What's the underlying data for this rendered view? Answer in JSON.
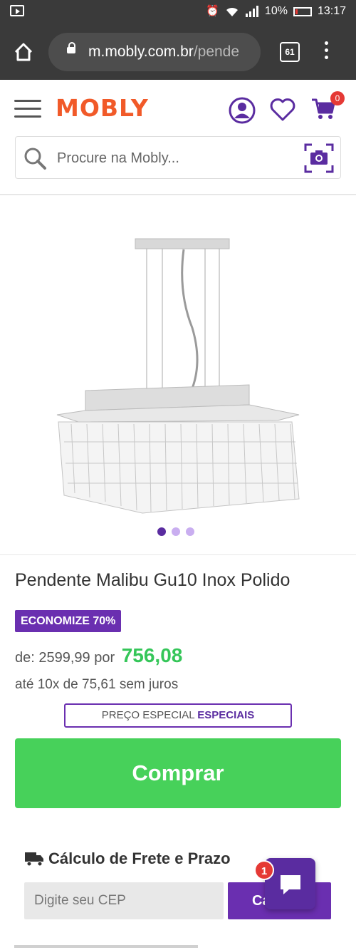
{
  "status_bar": {
    "battery": "10%",
    "time": "13:17"
  },
  "browser": {
    "url_host": "m.mobly.com.br",
    "url_path": "/pende",
    "tab_count": "61"
  },
  "header": {
    "logo": "MOBLY",
    "cart_count": "0",
    "brand_color": "#f15a29",
    "accent_color": "#5a2ca0"
  },
  "search": {
    "placeholder": "Procure na Mobly..."
  },
  "gallery": {
    "slide_count": 3,
    "active_slide": 1
  },
  "product": {
    "title": "Pendente Malibu Gu10 Inox Polido",
    "discount_badge": "ECONOMIZE 70%",
    "price_from_label": "de:",
    "price_from": "2599,99",
    "price_by_label": "por",
    "price_now": "756,08",
    "installments": "até 10x de 75,61 sem juros",
    "special_label": "PREÇO ESPECIAL",
    "special_value": "ESPECIAIS",
    "buy_label": "Comprar"
  },
  "shipping": {
    "title": "Cálculo de Frete e Prazo",
    "cep_placeholder": "Digite seu CEP",
    "calc_button": "Ca"
  },
  "chat": {
    "unread": "1"
  }
}
